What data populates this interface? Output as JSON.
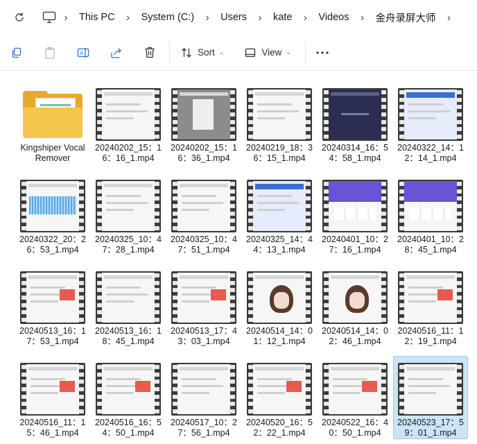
{
  "breadcrumb": [
    "This PC",
    "System (C:)",
    "Users",
    "kate",
    "Videos",
    "金舟录屏大师"
  ],
  "commandbar": {
    "sort_label": "Sort",
    "view_label": "View"
  },
  "files": [
    {
      "name": "Kingshiper Vocal Remover",
      "kind": "folder"
    },
    {
      "name": "20240202_15：16：16_1.mp4",
      "kind": "video",
      "thumb": "light"
    },
    {
      "name": "20240202_15：16：36_1.mp4",
      "kind": "video",
      "thumb": "gray"
    },
    {
      "name": "20240219_18：36：15_1.mp4",
      "kind": "video",
      "thumb": "doc"
    },
    {
      "name": "20240314_16：54：58_1.mp4",
      "kind": "video",
      "thumb": "dark"
    },
    {
      "name": "20240322_14：12：14_1.mp4",
      "kind": "video",
      "thumb": "blue"
    },
    {
      "name": "20240322_20：26：53_1.mp4",
      "kind": "video",
      "thumb": "wave"
    },
    {
      "name": "20240325_10：47：28_1.mp4",
      "kind": "video",
      "thumb": "light"
    },
    {
      "name": "20240325_10：47：51_1.mp4",
      "kind": "video",
      "thumb": "light"
    },
    {
      "name": "20240325_14：44：13_1.mp4",
      "kind": "video",
      "thumb": "blue"
    },
    {
      "name": "20240401_10：27：16_1.mp4",
      "kind": "video",
      "thumb": "purple"
    },
    {
      "name": "20240401_10：28：45_1.mp4",
      "kind": "video",
      "thumb": "purple"
    },
    {
      "name": "20240513_16：17：53_1.mp4",
      "kind": "video",
      "thumb": "accent"
    },
    {
      "name": "20240513_16：18：45_1.mp4",
      "kind": "video",
      "thumb": "doc"
    },
    {
      "name": "20240513_17：43：03_1.mp4",
      "kind": "video",
      "thumb": "accent"
    },
    {
      "name": "20240514_14：01：12_1.mp4",
      "kind": "video",
      "thumb": "face"
    },
    {
      "name": "20240514_14：02：46_1.mp4",
      "kind": "video",
      "thumb": "face"
    },
    {
      "name": "20240516_11：12：19_1.mp4",
      "kind": "video",
      "thumb": "accent"
    },
    {
      "name": "20240516_11：15：46_1.mp4",
      "kind": "video",
      "thumb": "accent"
    },
    {
      "name": "20240516_16：54：50_1.mp4",
      "kind": "video",
      "thumb": "accent"
    },
    {
      "name": "20240517_10：27：56_1.mp4",
      "kind": "video",
      "thumb": "doc"
    },
    {
      "name": "20240520_16：52：22_1.mp4",
      "kind": "video",
      "thumb": "accent"
    },
    {
      "name": "20240522_16：40：50_1.mp4",
      "kind": "video",
      "thumb": "accent"
    },
    {
      "name": "20240523_17：59：01_1.mp4",
      "kind": "video",
      "thumb": "doc",
      "selected": true
    }
  ]
}
